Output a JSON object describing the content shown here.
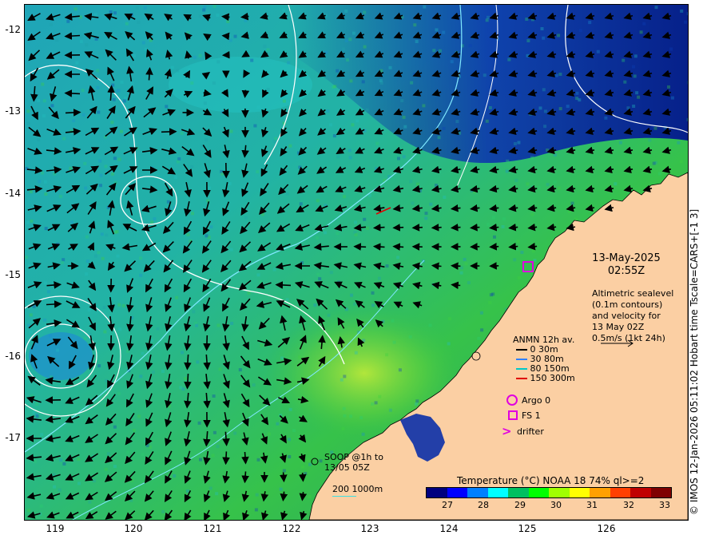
{
  "map": {
    "y_ticks": [
      "-12",
      "-13",
      "-14",
      "-15",
      "-16",
      "-17"
    ],
    "x_ticks": [
      "119",
      "120",
      "121",
      "122",
      "123",
      "124",
      "125",
      "126"
    ],
    "date_line1": "13-May-2025",
    "date_line2": "02:55Z",
    "altimetry_note": [
      "Altimetric sealevel",
      "(0.1m contours)",
      "and velocity for",
      "13 May 02Z",
      "0.5m/s (1kt 24h)"
    ],
    "anmn_title": "ANMN 12h av.",
    "anmn_items": [
      {
        "label": "0 30m",
        "color": "#000000"
      },
      {
        "label": "30 80m",
        "color": "#2f7fff"
      },
      {
        "label": "80 150m",
        "color": "#00c8c8"
      },
      {
        "label": "150 300m",
        "color": "#e00000"
      }
    ],
    "argo_label": "Argo 0",
    "fs_label": "FS 1",
    "drifter_label": "drifter",
    "soop_label": [
      "SOOP @1h to",
      "13/05 05Z"
    ],
    "contour_legend": "200  1000m",
    "colorbar_title": "Temperature (°C) NOAA 18 74% ql>=2",
    "colorbar_ticks": [
      "27",
      "28",
      "29",
      "30",
      "31",
      "32",
      "33"
    ],
    "colorbar_colors": [
      "#00007f",
      "#0000ff",
      "#0080ff",
      "#00ffff",
      "#00c060",
      "#00ff00",
      "#a0ff00",
      "#ffff00",
      "#ffa000",
      "#ff4000",
      "#c00000",
      "#7f0000"
    ],
    "credit": "© IMOS 12-Jan-2026 05:11:02 Hobart time Tscale=CARS+[-1 3]",
    "colors": {
      "land": "#fbcfa3",
      "sea_deep": "#1a6fd8",
      "sea_mid": "#20b8c0",
      "sea_warm": "#34c040",
      "sea_hot": "#a6e040",
      "magenta": "#e000e0",
      "contour": "#ffffff",
      "isobath": "#80e8ff"
    }
  }
}
